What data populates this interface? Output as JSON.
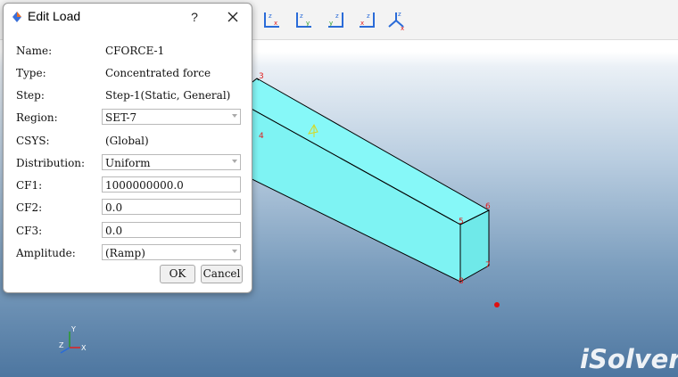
{
  "dialog": {
    "title": "Edit Load",
    "help_label": "?",
    "fields": {
      "name": {
        "label": "Name:",
        "value": "CFORCE-1"
      },
      "type": {
        "label": "Type:",
        "value": "Concentrated force"
      },
      "step": {
        "label": "Step:",
        "value": "Step-1(Static, General)"
      },
      "region": {
        "label": "Region:",
        "value": "SET-7"
      },
      "csys": {
        "label": "CSYS:",
        "value": "(Global)"
      },
      "distribution": {
        "label": "Distribution:",
        "value": "Uniform"
      },
      "cf1": {
        "label": "CF1:",
        "value": "1000000000.0"
      },
      "cf2": {
        "label": "CF2:",
        "value": "0.0"
      },
      "cf3": {
        "label": "CF3:",
        "value": "0.0"
      },
      "amplitude": {
        "label": "Amplitude:",
        "value": "(Ramp)"
      }
    },
    "buttons": {
      "ok": "OK",
      "cancel": "Cancel"
    }
  },
  "model": {
    "node_labels": [
      "3",
      "4",
      "5",
      "6",
      "7",
      "8"
    ],
    "beam_color": "#7ef5f5",
    "label_color": "#e02020"
  },
  "toolbar_icons": [
    "view-xz-icon",
    "view-zy-icon",
    "view-zx-icon",
    "view-yz-icon",
    "view-xz-alt-icon",
    "view-iso-icon"
  ],
  "triad_labels": {
    "x": "X",
    "y": "Y",
    "z": "Z"
  },
  "watermark": "iSolver"
}
